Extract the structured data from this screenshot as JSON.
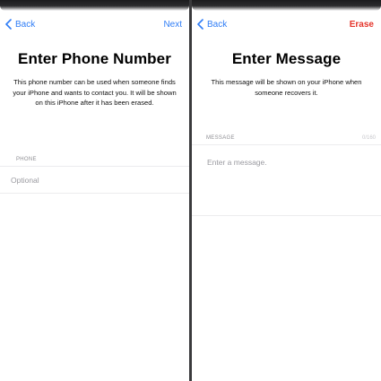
{
  "phone_screen": {
    "back_label": "Back",
    "next_label": "Next",
    "title": "Enter Phone Number",
    "description": "This phone number can be used when someone finds your iPhone and wants to contact you. It will be shown on this iPhone after it has been erased.",
    "field_label": "PHONE",
    "field_placeholder": "Optional"
  },
  "message_screen": {
    "back_label": "Back",
    "erase_label": "Erase",
    "title": "Enter Message",
    "description": "This message will be shown on your iPhone when someone recovers it.",
    "field_label": "MESSAGE",
    "counter": "0/160",
    "field_placeholder": "Enter a message."
  },
  "colors": {
    "accent": "#2f7df6",
    "destructive": "#e5342a",
    "secondary_text": "#8e8e93"
  },
  "icons": {
    "back": "chevron-left-icon"
  }
}
